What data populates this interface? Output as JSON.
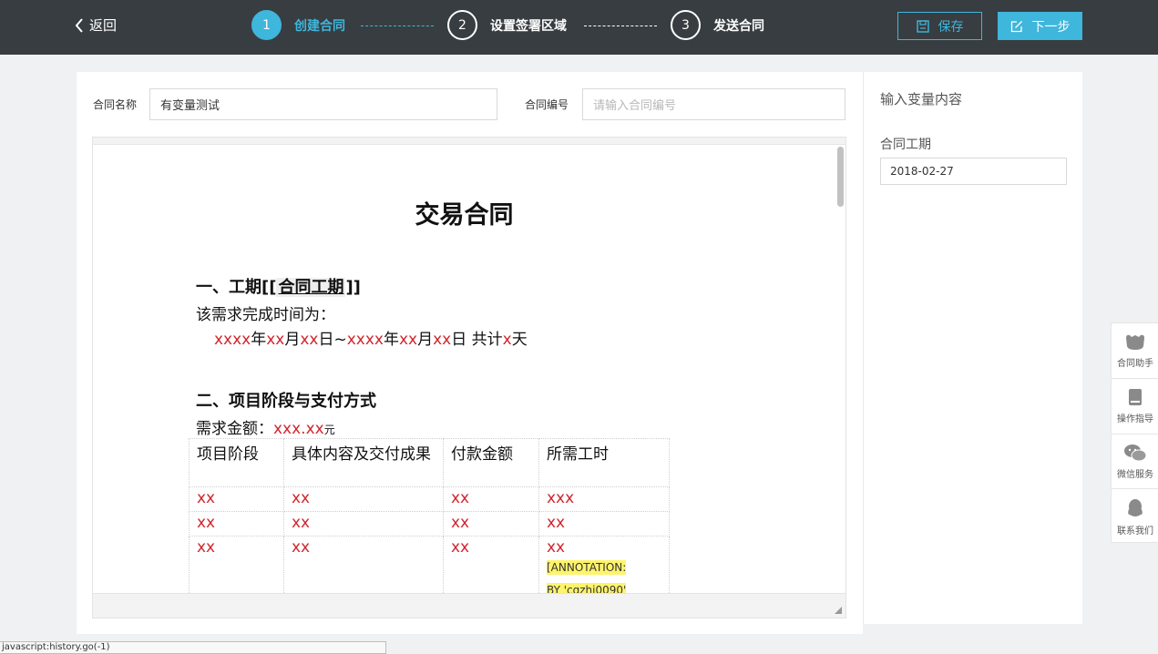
{
  "header": {
    "back_label": "返回",
    "steps": [
      {
        "num": "1",
        "label": "创建合同",
        "active": true
      },
      {
        "num": "2",
        "label": "设置签署区域",
        "active": false
      },
      {
        "num": "3",
        "label": "发送合同",
        "active": false
      }
    ],
    "save_label": "保存",
    "next_label": "下一步"
  },
  "form": {
    "name_label": "合同名称",
    "name_value": "有变量测试",
    "number_label": "合同编号",
    "number_placeholder": "请输入合同编号"
  },
  "document": {
    "title": "交易合同",
    "section1": {
      "heading_prefix": "一、工期[[",
      "variable": "合同工期",
      "heading_suffix": "]]",
      "line1": "该需求完成时间为：",
      "line2": [
        {
          "t": "xxxx",
          "red": true
        },
        {
          "t": "年",
          "red": false
        },
        {
          "t": "xx",
          "red": true
        },
        {
          "t": "月",
          "red": false
        },
        {
          "t": "xx",
          "red": true
        },
        {
          "t": "日~",
          "red": false
        },
        {
          "t": "xxxx",
          "red": true
        },
        {
          "t": "年",
          "red": false
        },
        {
          "t": "xx",
          "red": true
        },
        {
          "t": "月",
          "red": false
        },
        {
          "t": "xx",
          "red": true
        },
        {
          "t": "日  共计",
          "red": false
        },
        {
          "t": "x",
          "red": true
        },
        {
          "t": "天",
          "red": false
        }
      ]
    },
    "section2": {
      "heading": "二、项目阶段与支付方式",
      "amount_label": "需求金额：",
      "amount_value": "xxx.xx",
      "amount_unit": "元",
      "table_headers": [
        "项目阶段",
        "具体内容及交付成果",
        "付款金额",
        "所需工时"
      ],
      "table_rows": [
        [
          "xx",
          "xx",
          "xx",
          "xxx"
        ],
        [
          "xx",
          "xx",
          "xx",
          "xx"
        ],
        [
          "xx",
          "xx",
          "xx",
          "xx"
        ]
      ],
      "annotation_line1": "[ANNOTATION:",
      "annotation_line2": "BY 'cgzhi0090'"
    }
  },
  "right_panel": {
    "title": "输入变量内容",
    "field_label": "合同工期",
    "field_value": "2018-02-27"
  },
  "float_tools": [
    {
      "label": "合同助手",
      "icon": "assistant-icon"
    },
    {
      "label": "操作指导",
      "icon": "book-icon"
    },
    {
      "label": "微信服务",
      "icon": "wechat-icon"
    },
    {
      "label": "联系我们",
      "icon": "qq-icon"
    }
  ],
  "status_bar": "javascript:history.go(-1)",
  "colors": {
    "accent": "#3fb6dc",
    "topbar": "#373d41",
    "variable_red": "#d0262d",
    "annotation": "#fff36b"
  }
}
